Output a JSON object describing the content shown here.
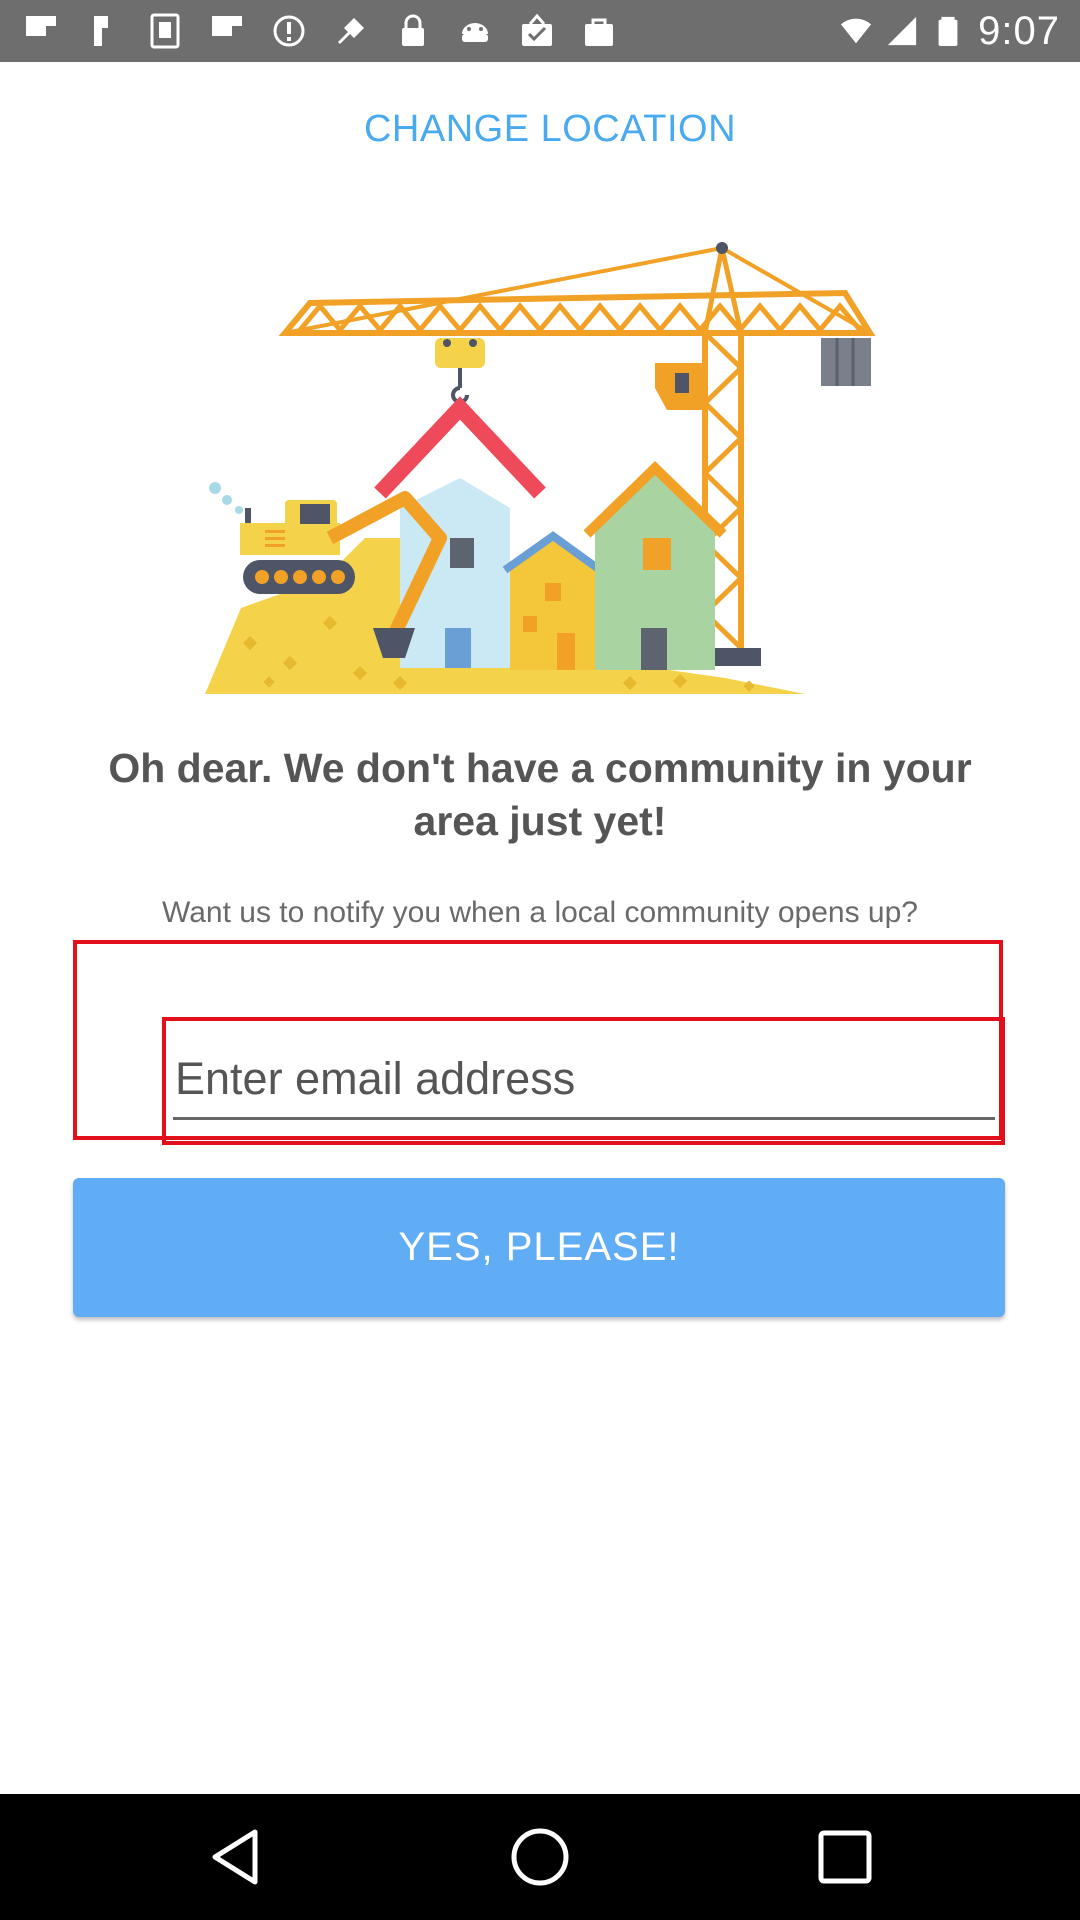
{
  "status_bar": {
    "time": "9:07",
    "icons": [
      "flipboard-icon",
      "flipboard-icon",
      "sim-toolkit-icon",
      "flipboard-icon",
      "alert-icon",
      "fake-gps-icon",
      "lock-icon",
      "android-debug-icon",
      "clipboard-check-icon",
      "shopping-bag-icon"
    ],
    "right_icons": [
      "wifi-icon",
      "signal-icon",
      "battery-icon"
    ]
  },
  "header": {
    "change_location_label": "CHANGE LOCATION",
    "link_color": "#4aaaf0"
  },
  "illustration": {
    "icon": "construction-crane-houses-illustration"
  },
  "message": {
    "headline": "Oh dear. We don't have a community in your area just yet!",
    "subline": "Want us to notify you when a local community opens up?"
  },
  "form": {
    "email_value": "",
    "email_placeholder": "Enter email address",
    "submit_label": "YES, PLEASE!",
    "button_color": "#61adf5",
    "highlight_color": "#e3101c"
  },
  "nav_bar": {
    "buttons": [
      "back-icon",
      "home-icon",
      "recents-icon"
    ]
  }
}
